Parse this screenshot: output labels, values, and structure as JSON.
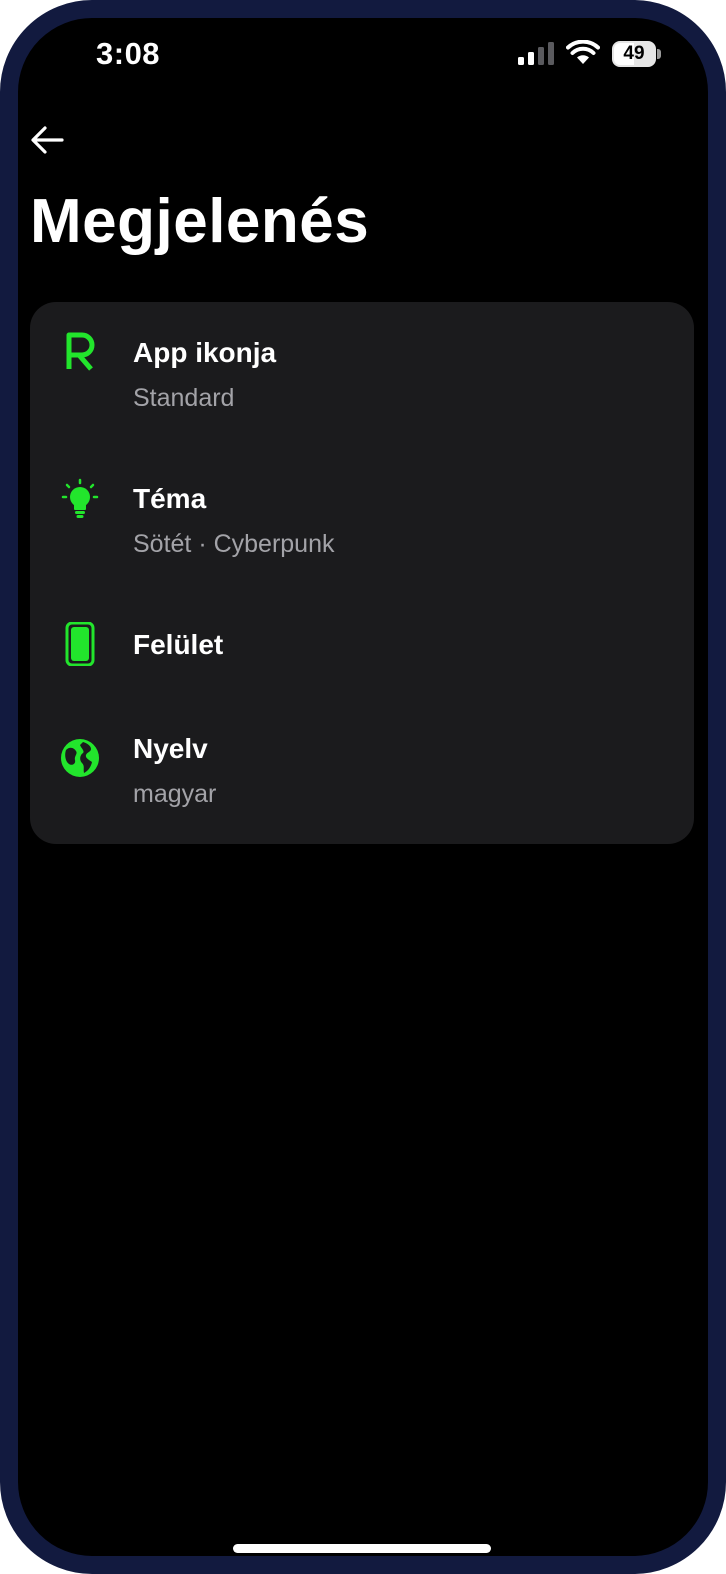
{
  "status_bar": {
    "time": "3:08",
    "battery_level": "49",
    "signal_icon": "cellular-signal-icon",
    "wifi_icon": "wifi-icon",
    "battery_icon": "battery-icon"
  },
  "header": {
    "back_icon": "arrow-left-icon",
    "title": "Megjelenés"
  },
  "settings": {
    "items": [
      {
        "title": "App ikonja",
        "subtitle": "Standard",
        "icon": "app-logo-r-icon"
      },
      {
        "title": "Téma",
        "subtitle": "Sötét · Cyberpunk",
        "icon": "lightbulb-icon"
      },
      {
        "title": "Felület",
        "subtitle": "",
        "icon": "phone-icon"
      },
      {
        "title": "Nyelv",
        "subtitle": "magyar",
        "icon": "globe-icon"
      }
    ]
  },
  "colors": {
    "accent": "#22e52c",
    "background": "#000000",
    "card": "#1b1b1d",
    "frame": "#121a3f",
    "secondary_text": "#a3a3a8"
  }
}
